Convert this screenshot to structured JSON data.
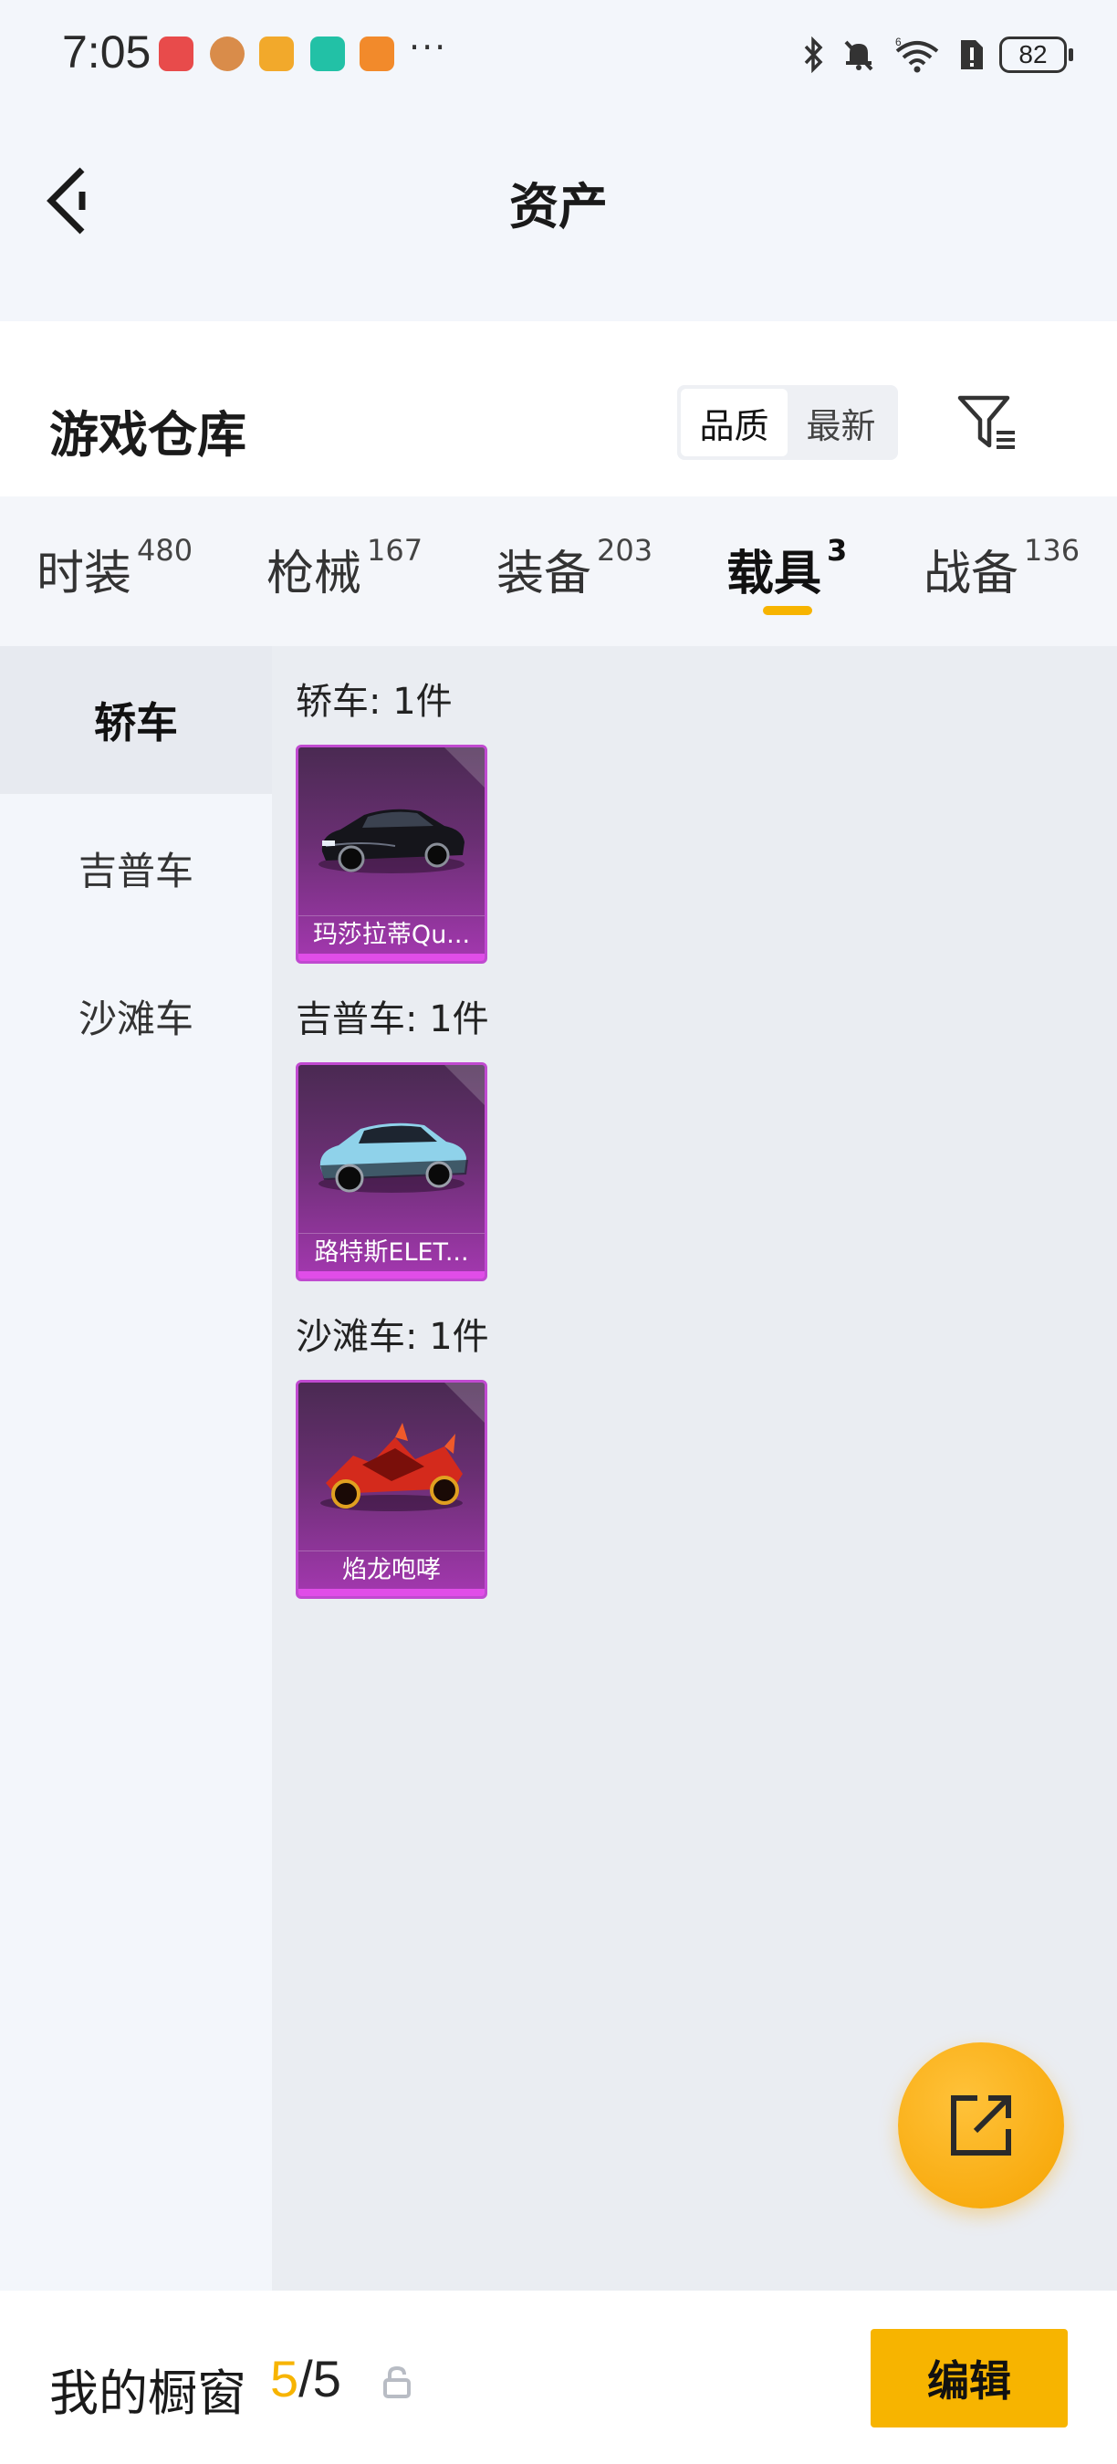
{
  "status_bar": {
    "time": "7:05",
    "signal_label": "6",
    "battery": "82"
  },
  "header": {
    "title": "资产"
  },
  "warehouse": {
    "title": "游戏仓库",
    "sort_options": [
      "品质",
      "最新"
    ],
    "sort_selected": "品质"
  },
  "tabs": [
    {
      "label": "时装",
      "count": "480"
    },
    {
      "label": "枪械",
      "count": "167"
    },
    {
      "label": "装备",
      "count": "203"
    },
    {
      "label": "载具",
      "count": "3",
      "active": true
    },
    {
      "label": "战备",
      "count": "136"
    }
  ],
  "sidebar": {
    "items": [
      "轿车",
      "吉普车",
      "沙滩车"
    ],
    "selected": "轿车"
  },
  "groups": [
    {
      "title": "轿车: 1件",
      "items": [
        {
          "name": "玛莎拉蒂Qu..."
        }
      ]
    },
    {
      "title": "吉普车: 1件",
      "items": [
        {
          "name": "路特斯ELET..."
        }
      ]
    },
    {
      "title": "沙滩车: 1件",
      "items": [
        {
          "name": "焰龙咆哮"
        }
      ]
    }
  ],
  "bottom_bar": {
    "title": "我的橱窗",
    "count_current": "5",
    "count_sep": "/",
    "count_total": "5",
    "edit_label": "编辑"
  },
  "colors": {
    "accent": "#f7b400",
    "card_purple": "#a438b0",
    "background": "#f3f6fb"
  },
  "icons": [
    "back-arrow-icon",
    "filter-icon",
    "share-icon",
    "lock-icon"
  ]
}
